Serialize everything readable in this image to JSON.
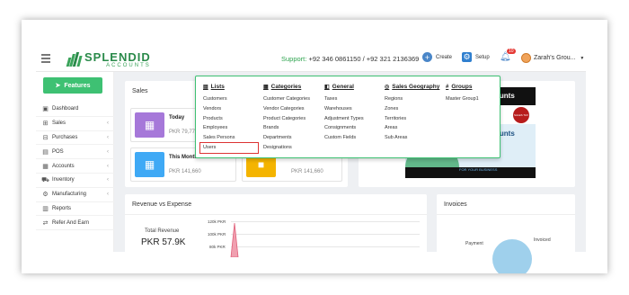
{
  "topbar": {
    "logo_name": "SPLENDID",
    "logo_sub": "ACCOUNTS",
    "support_label": "Support:",
    "support_numbers": "+92 346 0861150 / +92 321 2136369",
    "create_label": "Create",
    "setup_label": "Setup",
    "notification_count": "10",
    "user_name": "Zarah's Grou...",
    "icons": {
      "menu": "hamburger-icon",
      "create": "plus-circle-icon",
      "setup": "gear-icon",
      "notifications": "bell-icon",
      "dropdown": "caret-down-icon"
    }
  },
  "sidebar": {
    "features_label": "Features",
    "items": [
      {
        "label": "Dashboard",
        "icon": "dashboard-icon",
        "chevron": false
      },
      {
        "label": "Sales",
        "icon": "sales-icon",
        "chevron": true
      },
      {
        "label": "Purchases",
        "icon": "cart-icon",
        "chevron": true
      },
      {
        "label": "POS",
        "icon": "pos-icon",
        "chevron": true
      },
      {
        "label": "Accounts",
        "icon": "accounts-icon",
        "chevron": true
      },
      {
        "label": "Inventory",
        "icon": "inventory-icon",
        "chevron": true
      },
      {
        "label": "Manufacturing",
        "icon": "manufacturing-icon",
        "chevron": true
      },
      {
        "label": "Reports",
        "icon": "reports-icon",
        "chevron": false
      },
      {
        "label": "Refer And Earn",
        "icon": "refer-icon",
        "chevron": false
      }
    ]
  },
  "sales": {
    "title": "Sales",
    "today_label": "Today",
    "today_value": "PKR 79,770",
    "this_month_label": "This Month",
    "this_month_value": "PKR 141,660",
    "right_month_value": "PKR 141,660"
  },
  "setup_menu": {
    "lists": {
      "heading": "Lists",
      "items": [
        "Customers",
        "Vendors",
        "Products",
        "Employees",
        "Sales Persons",
        "Users"
      ]
    },
    "categories": {
      "heading": "Categories",
      "items": [
        "Customer Categories",
        "Vendor Categories",
        "Product Categories",
        "Brands",
        "Departments",
        "Designations"
      ]
    },
    "general": {
      "heading": "General",
      "items": [
        "Taxes",
        "Warehouses",
        "Adjustment Types",
        "Consignments",
        "Custom Fields"
      ]
    },
    "geography": {
      "heading": "Sales Geography",
      "items": [
        "Regions",
        "Zones",
        "Territories",
        "Areas",
        "Sub Areas"
      ]
    },
    "groups": {
      "heading": "Groups",
      "items": [
        "Master Group1"
      ]
    },
    "highlighted_item": "Users"
  },
  "promo": {
    "top_text": "ounts",
    "badge_text": "SALES TAX",
    "mid_text": "ounts",
    "footer_text": "FOR YOUR BUSINESS"
  },
  "revenue": {
    "title": "Revenue vs Expense",
    "total_label": "Total Revenue",
    "total_value": "PKR 57.9K",
    "ticks": [
      "120k PKR",
      "100k PKR",
      "80k PKR"
    ]
  },
  "invoices": {
    "title": "Invoices",
    "payment_label": "Payment",
    "invoiced_label": "Invoiced"
  },
  "colors": {
    "accent_green": "#3ec173",
    "brand_green": "#2a8a4a",
    "highlight_red": "#d33333"
  }
}
